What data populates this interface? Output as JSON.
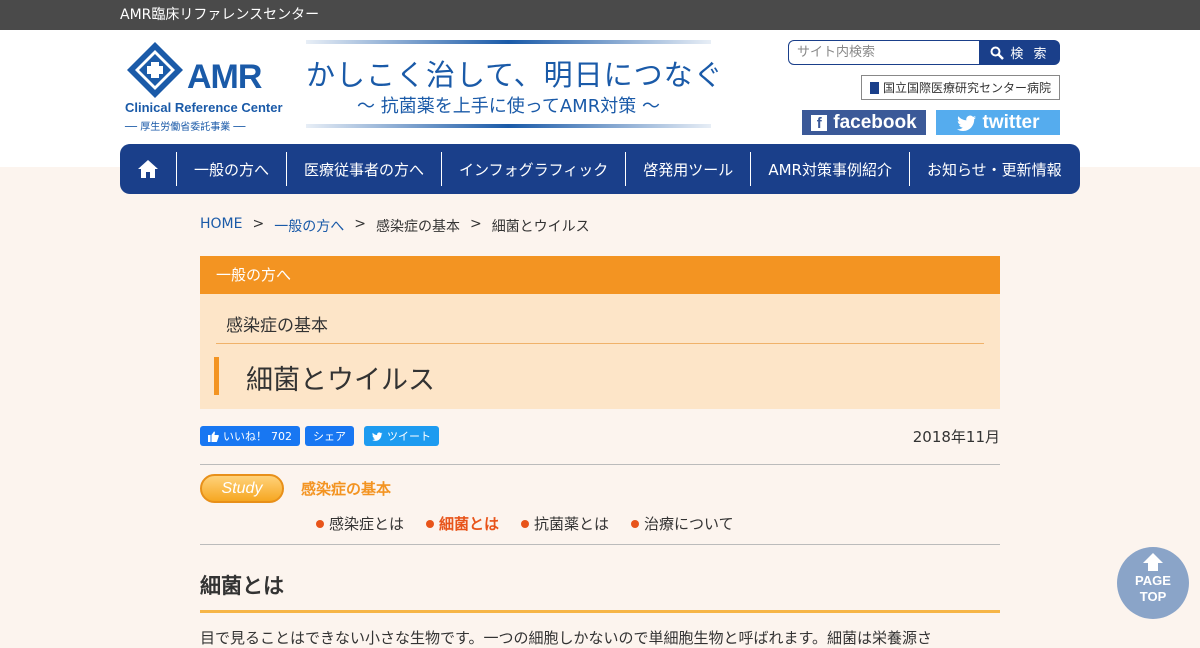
{
  "topbar": {
    "title": "AMR臨床リファレンスセンター"
  },
  "logo": {
    "name": "AMR",
    "sub": "Clinical Reference Center",
    "sub2": "── 厚生労働省委託事業 ──"
  },
  "tagline": {
    "main": "かしこく治して、明日につなぐ",
    "sub": "～ 抗菌薬を上手に使ってAMR対策 ～"
  },
  "search": {
    "placeholder": "サイト内検索",
    "button": "検 索"
  },
  "ncgm": {
    "label": "国立国際医療研究センター病院"
  },
  "sns": {
    "facebook": "facebook",
    "twitter": "twitter"
  },
  "nav": {
    "items": [
      "一般の方へ",
      "医療従事者の方へ",
      "インフォグラフィック",
      "啓発用ツール",
      "AMR対策事例紹介",
      "お知らせ・更新情報"
    ]
  },
  "breadcrumb": {
    "home": "HOME",
    "sep": ">",
    "general": "一般の方へ",
    "basics": "感染症の基本",
    "current": "細菌とウイルス"
  },
  "category": "一般の方へ",
  "section": "感染症の基本",
  "page_title": "細菌とウイルス",
  "social": {
    "like": "いいね！",
    "like_count": "702",
    "share": "シェア",
    "tweet": "ツイート"
  },
  "date": "2018年11月",
  "study": {
    "badge": "Study",
    "label": "感染症の基本",
    "links": [
      "感染症とは",
      "細菌とは",
      "抗菌薬とは",
      "治療について"
    ],
    "active": 1
  },
  "heading": "細菌とは",
  "body_text": "目で見ることはできない小さな生物です。一つの細胞しかないので単細胞生物と呼ばれます。細菌は栄養源さ",
  "pagetop": {
    "line1": "PAGE",
    "line2": "TOP"
  },
  "colors": {
    "navy": "#1a3f8a",
    "orange": "#f39422",
    "cream": "#fde5c8",
    "background": "#fcf4ee"
  }
}
